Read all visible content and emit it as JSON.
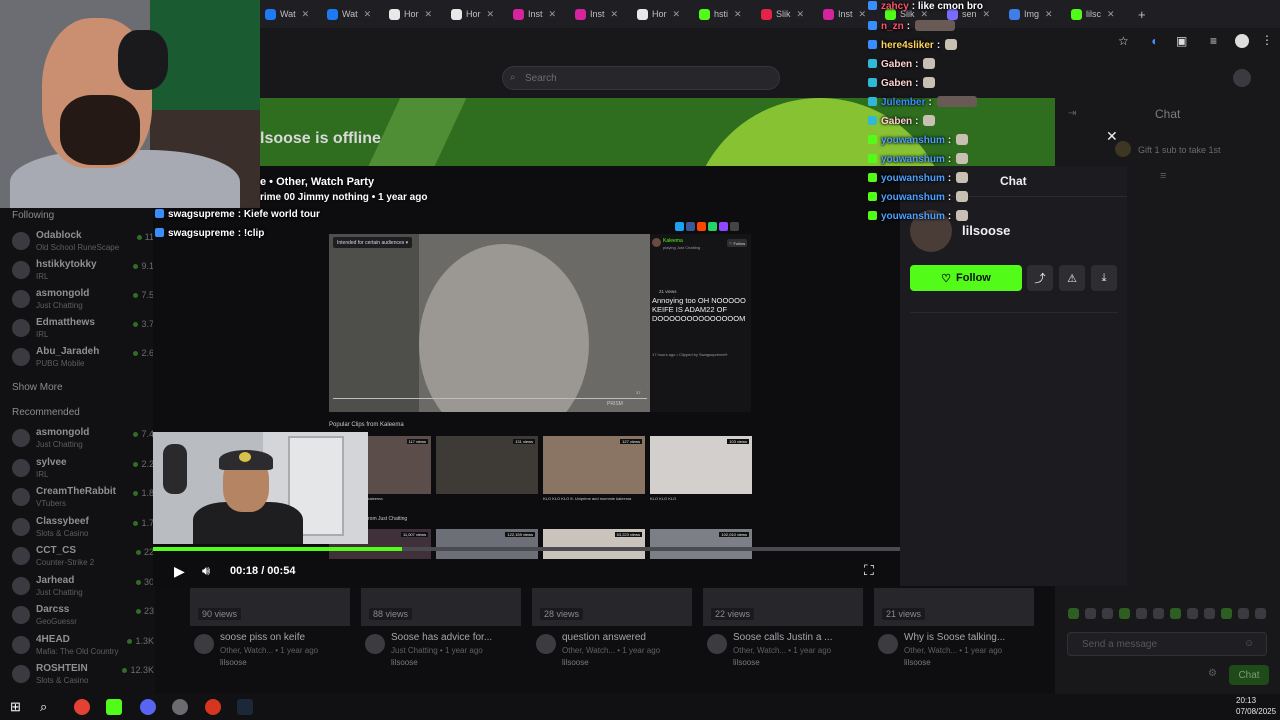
{
  "browser": {
    "tabs": [
      {
        "label": "Wat",
        "color": "#1d7af2"
      },
      {
        "label": "Wat",
        "color": "#1d7af2"
      },
      {
        "label": "Hor",
        "color": "#e8e8e8"
      },
      {
        "label": "Hor",
        "color": "#e8e8e8"
      },
      {
        "label": "Inst",
        "color": "#d6249f"
      },
      {
        "label": "Inst",
        "color": "#d6249f"
      },
      {
        "label": "Hor",
        "color": "#e8e8e8"
      },
      {
        "label": "hsti",
        "color": "#53fc18"
      },
      {
        "label": "Slik",
        "color": "#e3234a"
      },
      {
        "label": "Inst",
        "color": "#d6249f"
      },
      {
        "label": "Slik",
        "color": "#53fc18"
      },
      {
        "label": "sen",
        "color": "#7a6cff"
      },
      {
        "label": "Img",
        "color": "#3f7ee8"
      },
      {
        "label": "lilsc",
        "color": "#53fc18"
      }
    ]
  },
  "site": {
    "search_placeholder": "Search",
    "offline_text": "lsoose is offline",
    "chat_title": "Chat",
    "gift_sub": "Gift 1 sub to take 1st",
    "chat_placeholder": "Send a message",
    "chat_button": "Chat"
  },
  "stream_info": {
    "line1": "e • Other, Watch Party",
    "line2": "rime 00  Jimmy nothing  • 1 year ago"
  },
  "sidebar": {
    "following_label": "Following",
    "show_more": "Show More",
    "recommended_label": "Recommended",
    "following": [
      {
        "name": "Odablock",
        "game": "Old School RuneScape",
        "viewers": "11"
      },
      {
        "name": "hstikkytokky",
        "game": "IRL",
        "viewers": "9.1"
      },
      {
        "name": "asmongold",
        "game": "Just Chatting",
        "viewers": "7.5"
      },
      {
        "name": "Edmatthews",
        "game": "IRL",
        "viewers": "3.7"
      },
      {
        "name": "Abu_Jaradeh",
        "game": "PUBG Mobile",
        "viewers": "2.6"
      }
    ],
    "recommended": [
      {
        "name": "asmongold",
        "game": "Just Chatting",
        "viewers": "7.4"
      },
      {
        "name": "sylvee",
        "game": "IRL",
        "viewers": "2.2"
      },
      {
        "name": "CreamTheRabbit",
        "game": "VTubers",
        "viewers": "1.8"
      },
      {
        "name": "Classybeef",
        "game": "Slots & Casino",
        "viewers": "1.7"
      },
      {
        "name": "CCT_CS",
        "game": "Counter-Strike 2",
        "viewers": "22"
      },
      {
        "name": "Jarhead",
        "game": "Just Chatting",
        "viewers": "30"
      },
      {
        "name": "Darcss",
        "game": "GeoGuessr",
        "viewers": "23"
      },
      {
        "name": "4HEAD",
        "game": "Mafia: The Old Country",
        "viewers": "1.3K"
      },
      {
        "name": "ROSHTEIN",
        "game": "Slots & Casino",
        "viewers": "12.3K"
      }
    ]
  },
  "videos": [
    {
      "views": "90 views",
      "title": "soose piss on keife",
      "meta": "Other, Watch... • 1 year ago",
      "channel": "lilsoose"
    },
    {
      "views": "88 views",
      "title": "Soose has advice for...",
      "meta": "Just Chatting • 1 year ago",
      "channel": "lilsoose"
    },
    {
      "views": "28 views",
      "title": "question answered",
      "meta": "Other, Watch... • 1 year ago",
      "channel": "lilsoose"
    },
    {
      "views": "22 views",
      "title": "Soose calls Justin a ...",
      "meta": "Other, Watch... • 1 year ago",
      "channel": "lilsoose"
    },
    {
      "views": "21 views",
      "title": "Why is Soose talking...",
      "meta": "Other, Watch... • 1 year ago",
      "channel": "lilsoose"
    }
  ],
  "modal": {
    "chat_title": "Chat",
    "close_glyph": "✕",
    "streamer_name": "lilsoose",
    "follow_label": "Follow",
    "share_glyph": "⤴",
    "report_glyph": "⚠",
    "download_glyph": "⤓"
  },
  "nested_clip": {
    "audience_tag": "Intended for certain audiences ▾",
    "channel": "Kaleema",
    "channel_sub": "playing Just Chatting",
    "follow": "♡ Follow",
    "views": "21 views",
    "title": "Annoying too OH NOOOOO KEIFE IS ADAM22 OF DOOOOOOOOOOOOOOM",
    "meta": "17 hours ago • Clipped by SwagsupremeH",
    "brand": "PRISM",
    "time": "37",
    "popular_header": "Popular Clips from Kaleema",
    "just_chatting": "rom Just Chatting",
    "minis": [
      {
        "views": "117 views",
        "cap": "uplrime and mommie kaleema"
      },
      {
        "views": "131 views",
        "cap": ""
      },
      {
        "views": "127 views",
        "cap": "KLO KLO KLO ft. Uniprime and mommie kaleema"
      },
      {
        "views": "103 views",
        "cap": "KLO KLO KLO"
      },
      {
        "views": "11,007 views",
        "cap": ""
      },
      {
        "views": "122,159 views",
        "cap": ""
      },
      {
        "views": "53,223 views",
        "cap": ""
      },
      {
        "views": "102,010 views",
        "cap": ""
      }
    ]
  },
  "player": {
    "time": "00:18 / 00:54",
    "progress": 0.333
  },
  "overlay_chat": [
    {
      "user": "zahcy",
      "msg": "like cmon bro",
      "color": "#ff4f6a"
    },
    {
      "user": "n_zn",
      "msg": "",
      "color": "#ff4f6a"
    },
    {
      "user": "here4sliker",
      "msg": "",
      "color": "#ffd35c"
    },
    {
      "user": "Gaben",
      "msg": "",
      "color": "#ffd1d1"
    },
    {
      "user": "Gaben",
      "msg": "",
      "color": "#ffd1d1"
    },
    {
      "user": "Julember",
      "msg": "",
      "color": "#3a8dff"
    },
    {
      "user": "Gaben",
      "msg": "",
      "color": "#ffd1d1"
    },
    {
      "user": "youwanshum",
      "msg": "",
      "color": "#4ca0ff"
    },
    {
      "user": "youwanshum",
      "msg": "",
      "color": "#4ca0ff"
    },
    {
      "user": "youwanshum",
      "msg": "",
      "color": "#4ca0ff"
    },
    {
      "user": "youwanshum",
      "msg": "",
      "color": "#4ca0ff"
    },
    {
      "user": "youwanshum",
      "msg": "",
      "color": "#4ca0ff"
    },
    {
      "user": "swagsupreme",
      "msg": "Kiefe world tour",
      "color": "#ffffff"
    },
    {
      "user": "swagsupreme",
      "msg": "!clip",
      "color": "#ffffff"
    }
  ],
  "taskbar": {
    "time": "20:13",
    "date": "07/08/2025"
  }
}
